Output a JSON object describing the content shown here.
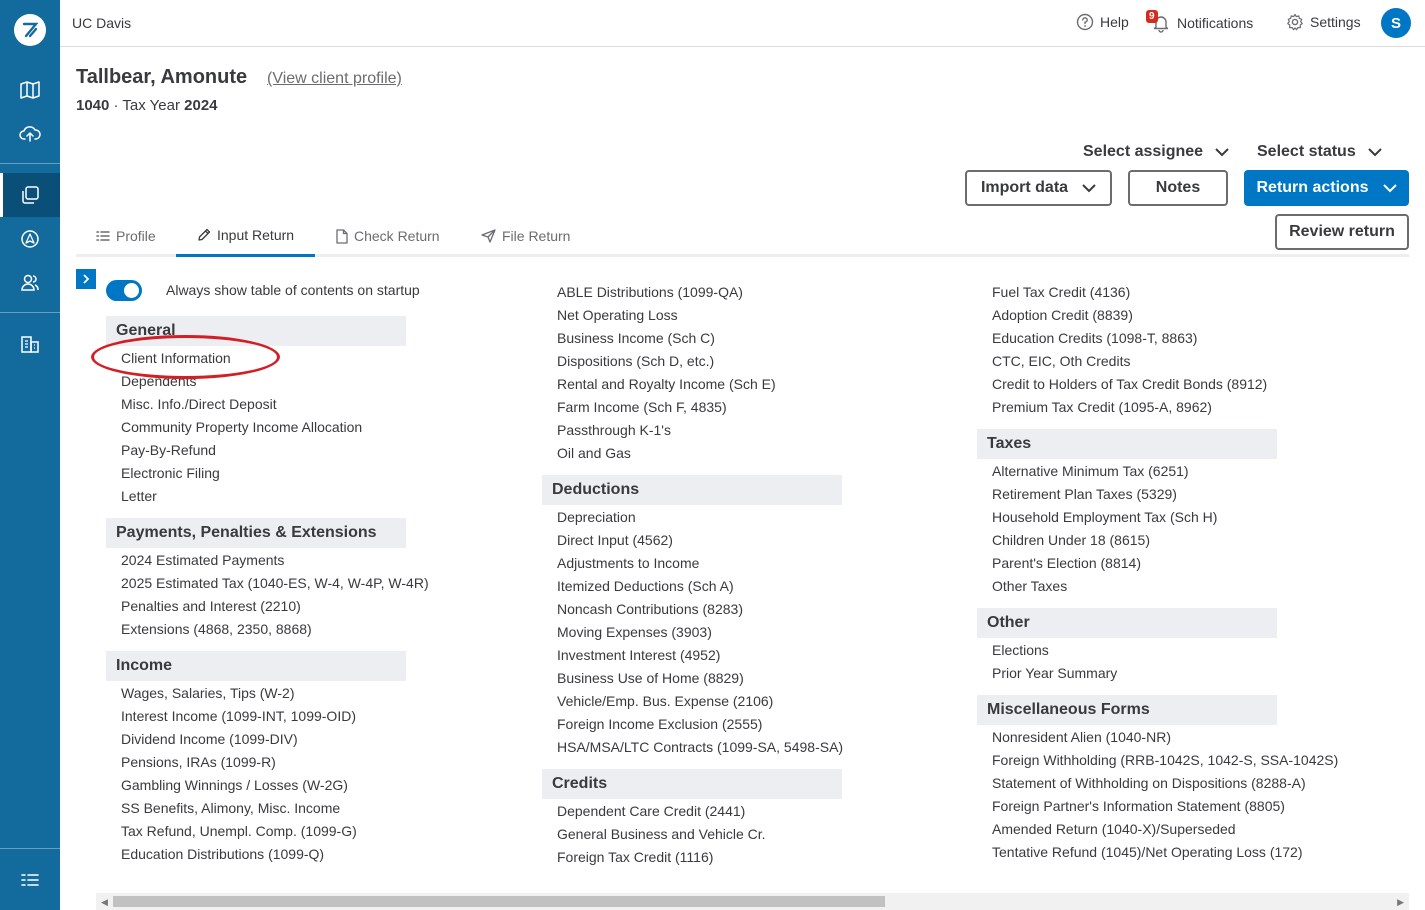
{
  "topbar": {
    "org": "UC Davis",
    "help": "Help",
    "notifications": "Notifications",
    "notifications_count": "9",
    "settings": "Settings",
    "avatar_initial": "S"
  },
  "client": {
    "name": "Tallbear, Amonute",
    "profile_link": "(View client profile)",
    "form": "1040",
    "separator": " · Tax Year ",
    "year": "2024"
  },
  "actions": {
    "assignee": "Select assignee",
    "status": "Select status",
    "import": "Import data",
    "notes": "Notes",
    "return_actions": "Return actions",
    "review": "Review return"
  },
  "tabs": [
    "Profile",
    "Input Return",
    "Check Return",
    "File Return"
  ],
  "toc": {
    "toggle_label": "Always show table of contents on startup",
    "general": {
      "title": "General",
      "items": [
        "Client Information",
        "Dependents",
        "Misc. Info./Direct Deposit",
        "Community Property Income Allocation",
        "Pay-By-Refund",
        "Electronic Filing",
        "Letter"
      ]
    },
    "payments": {
      "title": "Payments, Penalties & Extensions",
      "items": [
        "2024 Estimated Payments",
        "2025 Estimated Tax (1040-ES, W-4, W-4P, W-4R)",
        "Penalties and Interest (2210)",
        "Extensions (4868, 2350, 8868)"
      ]
    },
    "income": {
      "title": "Income",
      "items": [
        "Wages, Salaries, Tips (W-2)",
        "Interest Income (1099-INT, 1099-OID)",
        "Dividend Income (1099-DIV)",
        "Pensions, IRAs (1099-R)",
        "Gambling Winnings / Losses (W-2G)",
        "SS Benefits, Alimony, Misc. Income",
        "Tax Refund, Unempl. Comp. (1099-G)",
        "Education Distributions (1099-Q)"
      ]
    },
    "income_cont": {
      "items": [
        "ABLE Distributions (1099-QA)",
        "Net Operating Loss",
        "Business Income (Sch C)",
        "Dispositions (Sch D, etc.)",
        "Rental and Royalty Income (Sch E)",
        "Farm Income (Sch F, 4835)",
        "Passthrough K-1's",
        "Oil and Gas"
      ]
    },
    "deductions": {
      "title": "Deductions",
      "items": [
        "Depreciation",
        "Direct Input (4562)",
        "Adjustments to Income",
        "Itemized Deductions (Sch A)",
        "Noncash Contributions (8283)",
        "Moving Expenses (3903)",
        "Investment Interest (4952)",
        "Business Use of Home (8829)",
        "Vehicle/Emp. Bus. Expense (2106)",
        "Foreign Income Exclusion (2555)",
        "HSA/MSA/LTC Contracts (1099-SA, 5498-SA)"
      ]
    },
    "credits": {
      "title": "Credits",
      "items": [
        "Dependent Care Credit (2441)",
        "General Business and Vehicle Cr.",
        "Foreign Tax Credit (1116)"
      ]
    },
    "credits_cont": {
      "items": [
        "Fuel Tax Credit (4136)",
        "Adoption Credit (8839)",
        "Education Credits (1098-T, 8863)",
        "CTC, EIC, Oth Credits",
        "Credit to Holders of Tax Credit Bonds (8912)",
        "Premium Tax Credit (1095-A, 8962)"
      ]
    },
    "taxes": {
      "title": "Taxes",
      "items": [
        "Alternative Minimum Tax (6251)",
        "Retirement Plan Taxes (5329)",
        "Household Employment Tax (Sch H)",
        "Children Under 18 (8615)",
        "Parent's Election (8814)",
        "Other Taxes"
      ]
    },
    "other": {
      "title": "Other",
      "items": [
        "Elections",
        "Prior Year Summary"
      ]
    },
    "misc": {
      "title": "Miscellaneous Forms",
      "items": [
        "Nonresident Alien (1040-NR)",
        "Foreign Withholding (RRB-1042S, 1042-S, SSA-1042S)",
        "Statement of Withholding on Dispositions (8288-A)",
        "Foreign Partner's Information Statement (8805)",
        "Amended Return (1040-X)/Superseded",
        "Tentative Refund (1045)/Net Operating Loss (172)"
      ]
    }
  },
  "colors": {
    "sidebar": "#136a9c",
    "primary": "#0077c5",
    "highlight": "#d21f26"
  }
}
